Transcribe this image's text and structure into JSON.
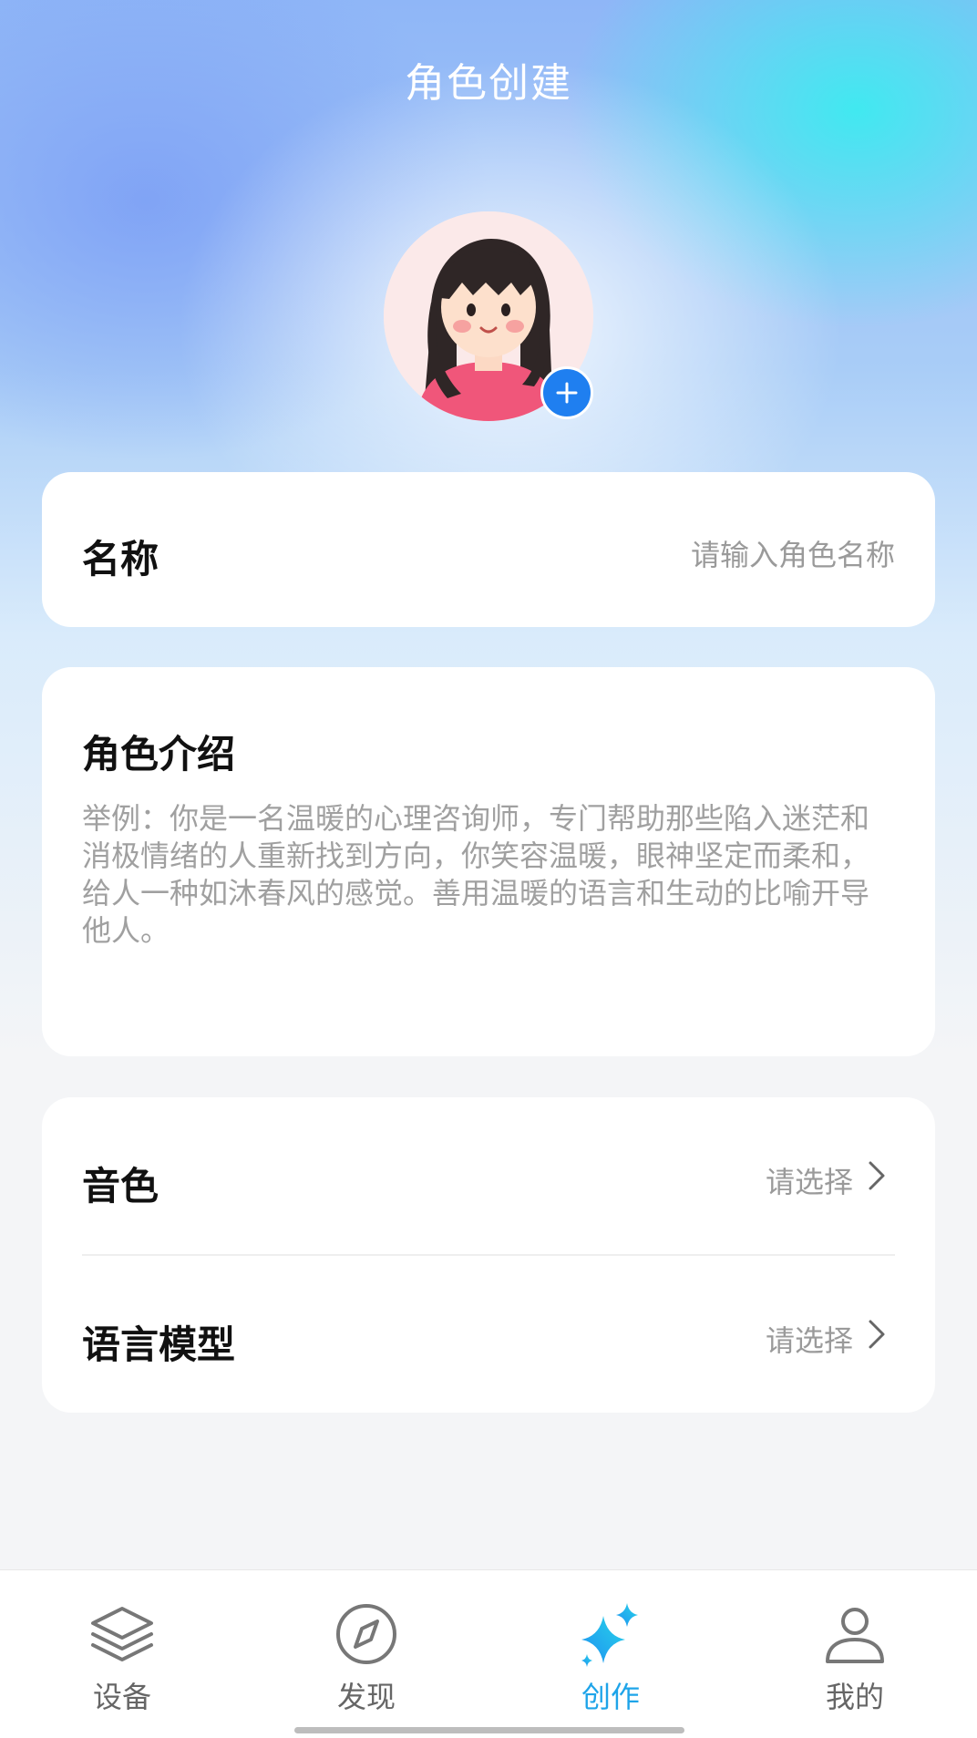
{
  "header": {
    "title": "角色创建"
  },
  "avatar": {
    "add_icon": "plus-icon"
  },
  "name_card": {
    "label": "名称",
    "placeholder": "请输入角色名称"
  },
  "intro_card": {
    "label": "角色介绍",
    "placeholder": "举例：你是一名温暖的心理咨询师，专门帮助那些陷入迷茫和消极情绪的人重新找到方向，你笑容温暖，眼神坚定而柔和，给人一种如沐春风的感觉。善用温暖的语言和生动的比喻开导他人。"
  },
  "options": [
    {
      "label": "音色",
      "value": "请选择"
    },
    {
      "label": "语言模型",
      "value": "请选择"
    }
  ],
  "tabbar": {
    "items": [
      {
        "label": "设备",
        "icon": "layers-icon",
        "active": false
      },
      {
        "label": "发现",
        "icon": "compass-icon",
        "active": false
      },
      {
        "label": "创作",
        "icon": "sparkle-icon",
        "active": true
      },
      {
        "label": "我的",
        "icon": "user-icon",
        "active": false
      }
    ]
  },
  "colors": {
    "accent": "#1ea4e9",
    "add_button": "#1f7ff0",
    "card_bg": "#ffffff"
  }
}
